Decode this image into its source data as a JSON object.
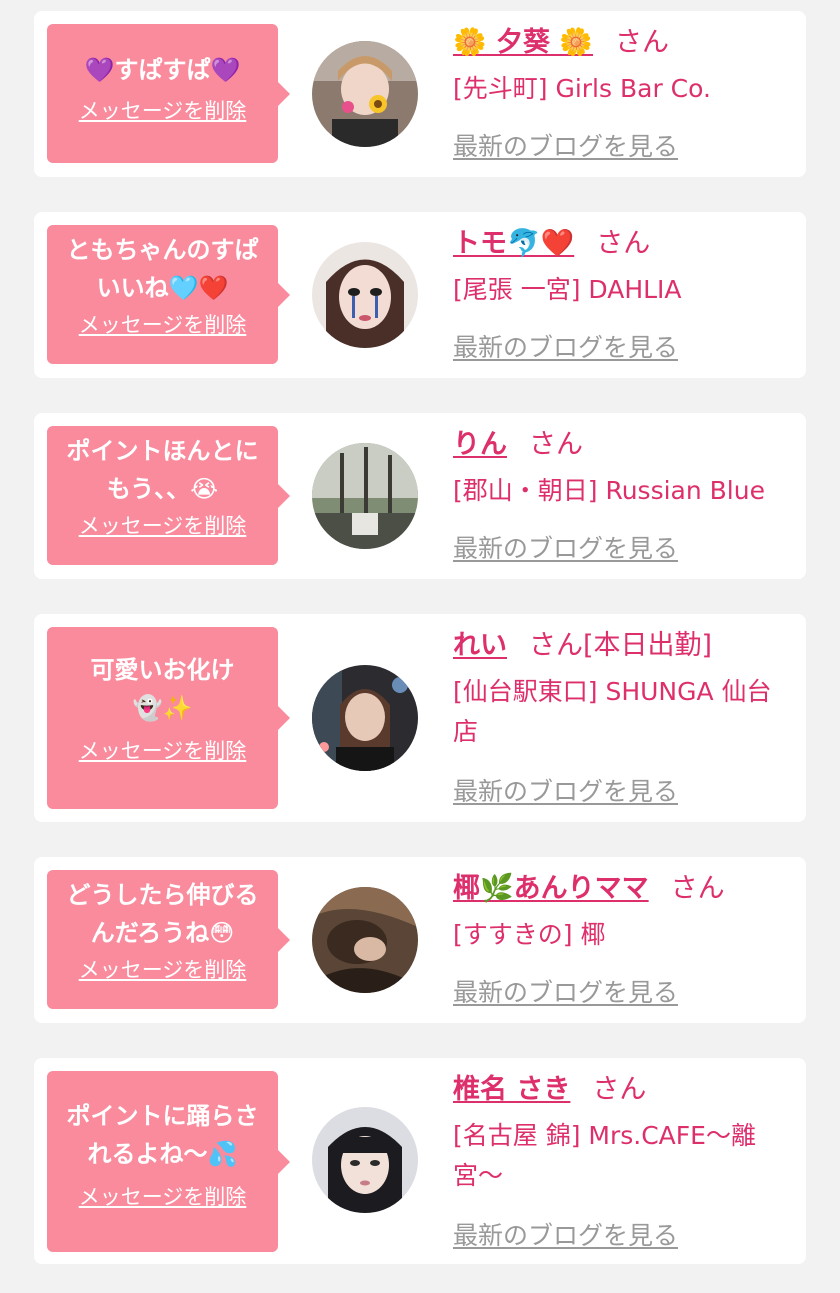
{
  "items": [
    {
      "message": "💜すぱすぱ💜",
      "delete_label": "メッセージを削除",
      "name": "🌼 夕葵 🌼",
      "honorific": "さん",
      "status": "",
      "shop": "[先斗町] Girls Bar Co.",
      "blog_label": "最新のブログを見る"
    },
    {
      "message": "ともちゃんのすぱいいね🩵❤️",
      "delete_label": "メッセージを削除",
      "name": "トモ🐬❤️",
      "honorific": "さん",
      "status": "",
      "shop": "[尾張 一宮] DAHLIA",
      "blog_label": "最新のブログを見る"
    },
    {
      "message": "ポイントほんとにもう、、😭",
      "delete_label": "メッセージを削除",
      "name": "りん",
      "honorific": "さん",
      "status": "",
      "shop": "[郡山・朝日] Russian Blue",
      "blog_label": "最新のブログを見る"
    },
    {
      "message": "可愛いお化け👻✨",
      "delete_label": "メッセージを削除",
      "name": "れい",
      "honorific": "さん",
      "status": "[本日出勤]",
      "shop": "[仙台駅東口] SHUNGA 仙台店",
      "blog_label": "最新のブログを見る"
    },
    {
      "message": "どうしたら伸びるんだろうね😳",
      "delete_label": "メッセージを削除",
      "name": "椰🌿あんりママ",
      "honorific": "さん",
      "status": "",
      "shop": "[すすきの] 椰",
      "blog_label": "最新のブログを見る"
    },
    {
      "message": "ポイントに踊らされるよね〜💦",
      "delete_label": "メッセージを削除",
      "name": "椎名 さき",
      "honorific": "さん",
      "status": "",
      "shop": "[名古屋 錦] Mrs.CAFE〜離宮〜",
      "blog_label": "最新のブログを見る"
    }
  ],
  "colors": {
    "background": "#f2f2f2",
    "card": "#ffffff",
    "bubble": "#f98b9d",
    "accent_pink": "#de2f6d",
    "blog_link_gray": "#999999"
  }
}
